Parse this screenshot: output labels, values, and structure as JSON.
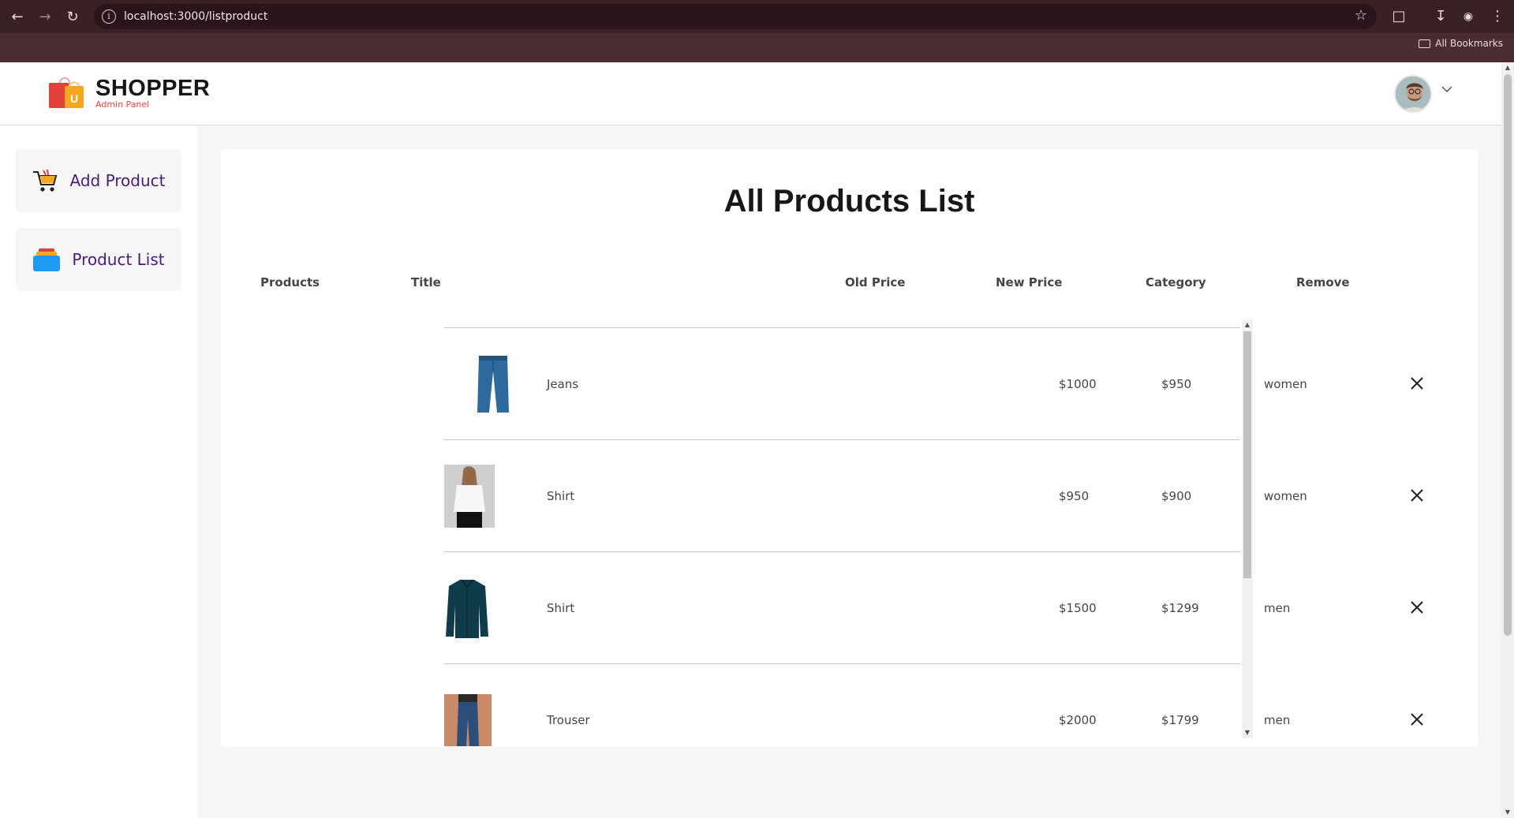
{
  "browser": {
    "url": "localhost:3000/listproduct",
    "bookmarks_label": "All Bookmarks"
  },
  "brand": {
    "title": "SHOPPER",
    "subtitle": "Admin Panel",
    "bag_letter": "U"
  },
  "sidebar": {
    "items": [
      {
        "label": "Add Product",
        "icon": "cart-icon"
      },
      {
        "label": "Product List",
        "icon": "stack-icon"
      }
    ]
  },
  "main": {
    "title": "All Products List",
    "columns": [
      "Products",
      "Title",
      "Old Price",
      "New Price",
      "Category",
      "Remove"
    ],
    "rows": [
      {
        "image": "jeans-image",
        "title": "Jeans",
        "old_price": "$1000",
        "new_price": "$950",
        "category": "women"
      },
      {
        "image": "white-blouse-image",
        "title": "Shirt",
        "old_price": "$950",
        "new_price": "$900",
        "category": "women"
      },
      {
        "image": "dark-shirt-image",
        "title": "Shirt",
        "old_price": "$1500",
        "new_price": "$1299",
        "category": "men"
      },
      {
        "image": "trouser-image",
        "title": "Trouser",
        "old_price": "$2000",
        "new_price": "$1799",
        "category": "men"
      }
    ]
  },
  "colors": {
    "accent": "#ff4141",
    "sidebar_text": "#4a1a7c",
    "chrome": "#4a2c31"
  }
}
